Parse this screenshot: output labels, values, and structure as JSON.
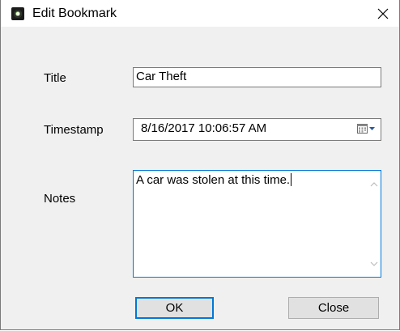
{
  "window": {
    "title": "Edit Bookmark",
    "app_icon": "camera-lens-icon",
    "close_icon": "close-icon"
  },
  "form": {
    "title_label": "Title",
    "title_value": "Car Theft",
    "timestamp_label": "Timestamp",
    "timestamp_value": "8/16/2017 10:06:57 AM",
    "calendar_icon": "calendar-dropdown-icon",
    "notes_label": "Notes",
    "notes_value": "A car was stolen at this time."
  },
  "buttons": {
    "ok_label": "OK",
    "close_label": "Close"
  },
  "colors": {
    "focus_border": "#0078d7",
    "dialog_background": "#f0f0f0",
    "button_background": "#e1e1e1"
  }
}
